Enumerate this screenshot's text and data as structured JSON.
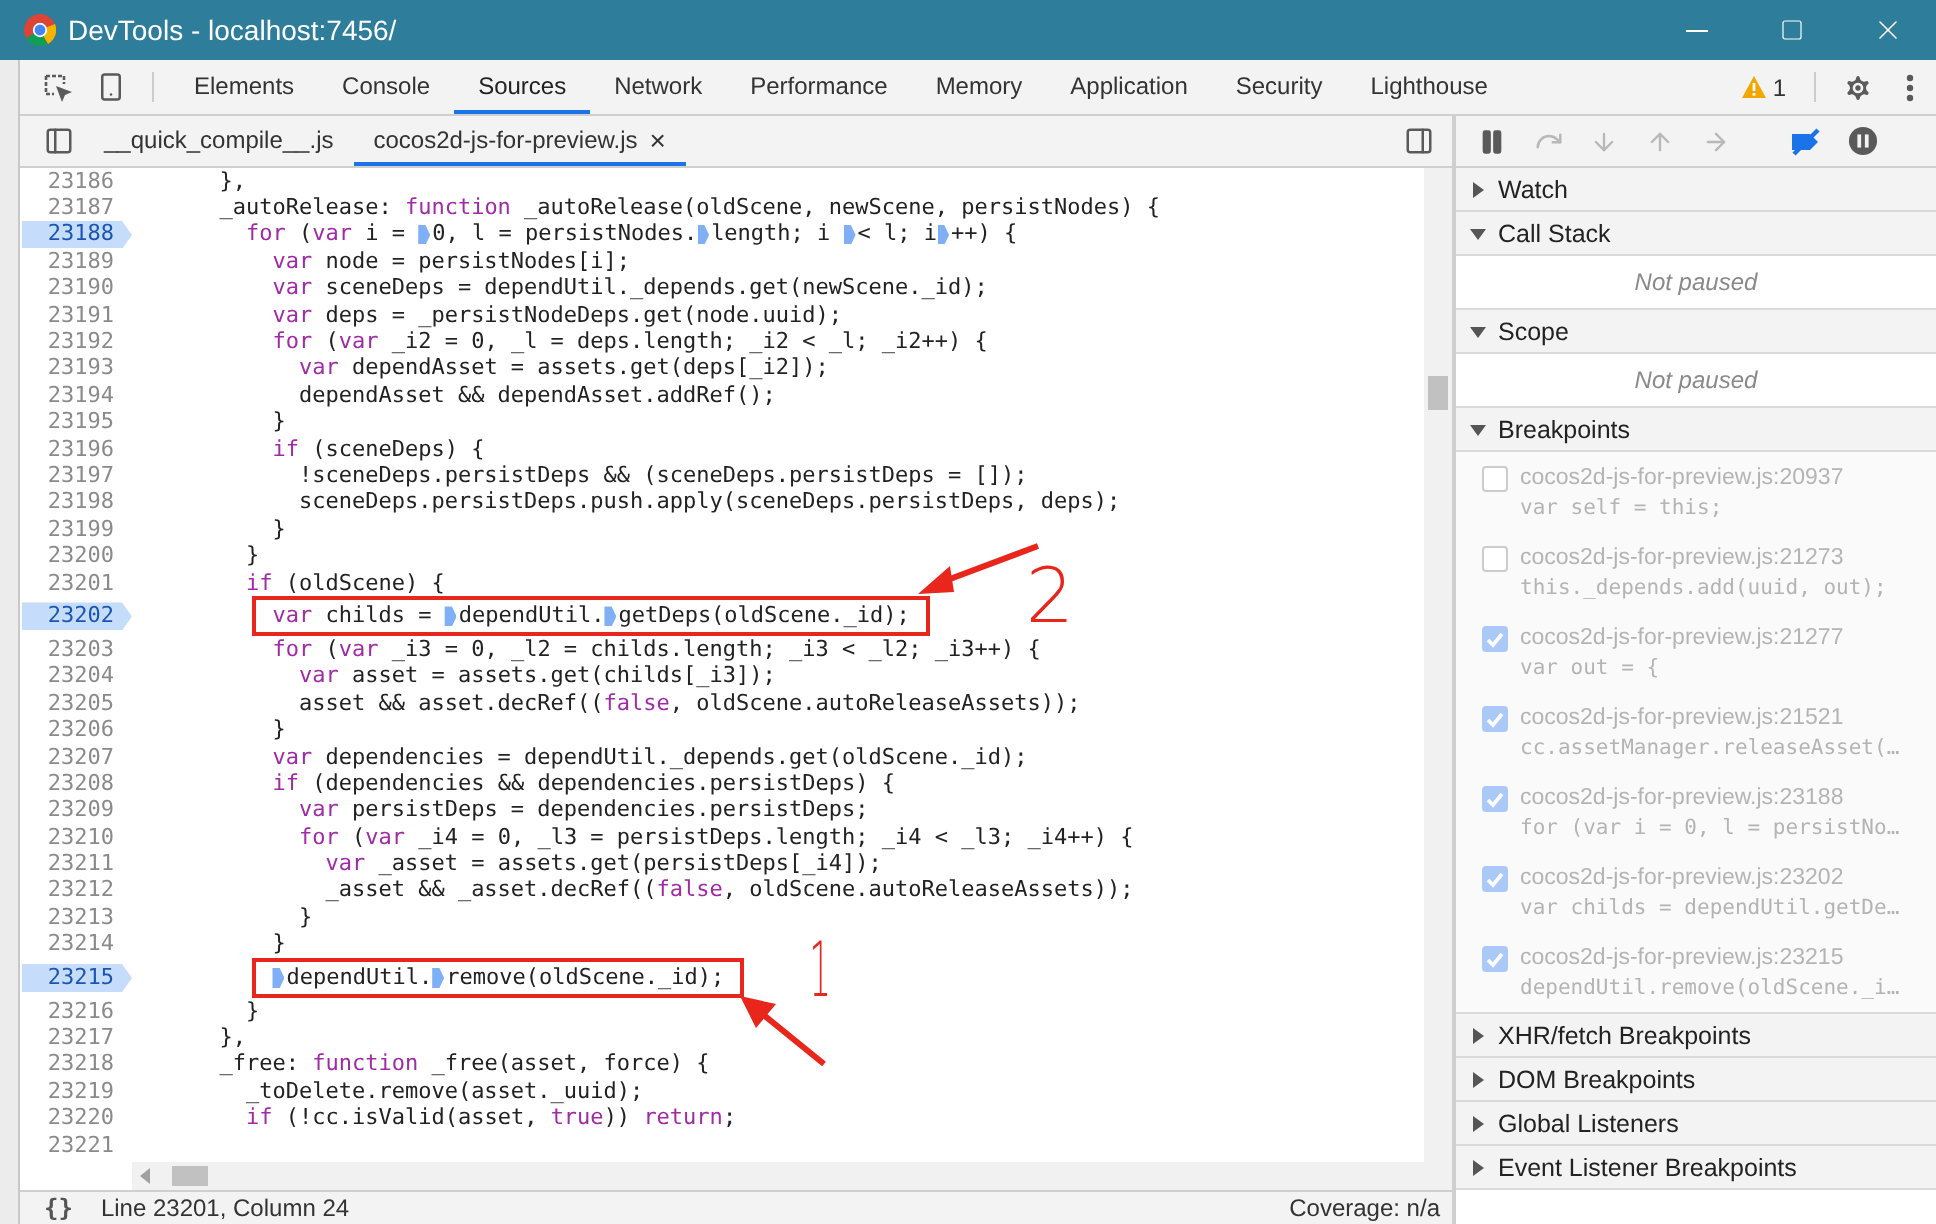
{
  "window": {
    "title": "DevTools - localhost:7456/"
  },
  "main_tabs": [
    {
      "label": "Elements",
      "selected": false
    },
    {
      "label": "Console",
      "selected": false
    },
    {
      "label": "Sources",
      "selected": true
    },
    {
      "label": "Network",
      "selected": false
    },
    {
      "label": "Performance",
      "selected": false
    },
    {
      "label": "Memory",
      "selected": false
    },
    {
      "label": "Application",
      "selected": false
    },
    {
      "label": "Security",
      "selected": false
    },
    {
      "label": "Lighthouse",
      "selected": false
    }
  ],
  "warning_count": "1",
  "file_tabs": [
    {
      "label": "__quick_compile__.js",
      "selected": false,
      "closable": false
    },
    {
      "label": "cocos2d-js-for-preview.js",
      "selected": true,
      "closable": true
    }
  ],
  "close_glyph": "×",
  "debug_toolbar": [
    {
      "kind": "pause",
      "disabled": false,
      "on": false
    },
    {
      "kind": "step_over",
      "disabled": true
    },
    {
      "kind": "step_into",
      "disabled": true
    },
    {
      "kind": "step_out",
      "disabled": true
    },
    {
      "kind": "step",
      "disabled": true
    },
    {
      "kind": "deactivate_breakpoints",
      "disabled": false,
      "on": true
    },
    {
      "kind": "pause_on_exceptions",
      "disabled": false,
      "on": false
    }
  ],
  "code_lines": [
    {
      "number": "23186",
      "breakpoint": false,
      "code": [
        {
          "kind": "plain",
          "text": "      },"
        }
      ]
    },
    {
      "number": "23187",
      "breakpoint": false,
      "code": [
        {
          "kind": "plain",
          "text": "      _autoRelease: "
        },
        {
          "kind": "keyword",
          "text": "function"
        },
        {
          "kind": "plain",
          "text": " _autoRelease(oldScene, newScene, persistNodes) {"
        }
      ]
    },
    {
      "number": "23188",
      "breakpoint": true,
      "code": [
        {
          "kind": "keyword",
          "text": "        for"
        },
        {
          "kind": "plain",
          "text": " ("
        },
        {
          "kind": "keyword",
          "text": "var"
        },
        {
          "kind": "plain",
          "text": " i = "
        },
        {
          "kind": "marker"
        },
        {
          "kind": "plain",
          "text": "0, l = persistNodes."
        },
        {
          "kind": "marker"
        },
        {
          "kind": "plain",
          "text": "length; i "
        },
        {
          "kind": "marker"
        },
        {
          "kind": "plain",
          "text": "< l; i"
        },
        {
          "kind": "marker"
        },
        {
          "kind": "plain",
          "text": "++) {"
        }
      ]
    },
    {
      "number": "23189",
      "breakpoint": false,
      "code": [
        {
          "kind": "keyword",
          "text": "          var"
        },
        {
          "kind": "plain",
          "text": " node = persistNodes[i];"
        }
      ]
    },
    {
      "number": "23190",
      "breakpoint": false,
      "code": [
        {
          "kind": "keyword",
          "text": "          var"
        },
        {
          "kind": "plain",
          "text": " sceneDeps = dependUtil._depends.get(newScene._id);"
        }
      ]
    },
    {
      "number": "23191",
      "breakpoint": false,
      "code": [
        {
          "kind": "keyword",
          "text": "          var"
        },
        {
          "kind": "plain",
          "text": " deps = _persistNodeDeps.get(node.uuid);"
        }
      ]
    },
    {
      "number": "23192",
      "breakpoint": false,
      "code": [
        {
          "kind": "keyword",
          "text": "          for"
        },
        {
          "kind": "plain",
          "text": " ("
        },
        {
          "kind": "keyword",
          "text": "var"
        },
        {
          "kind": "plain",
          "text": " _i2 = 0, _l = deps.length; _i2 < _l; _i2++) {"
        }
      ]
    },
    {
      "number": "23193",
      "breakpoint": false,
      "code": [
        {
          "kind": "keyword",
          "text": "            var"
        },
        {
          "kind": "plain",
          "text": " dependAsset = assets.get(deps[_i2]);"
        }
      ]
    },
    {
      "number": "23194",
      "breakpoint": false,
      "code": [
        {
          "kind": "plain",
          "text": "            dependAsset && dependAsset.addRef();"
        }
      ]
    },
    {
      "number": "23195",
      "breakpoint": false,
      "code": [
        {
          "kind": "plain",
          "text": "          }"
        }
      ]
    },
    {
      "number": "23196",
      "breakpoint": false,
      "code": [
        {
          "kind": "keyword",
          "text": "          if"
        },
        {
          "kind": "plain",
          "text": " (sceneDeps) {"
        }
      ]
    },
    {
      "number": "23197",
      "breakpoint": false,
      "code": [
        {
          "kind": "plain",
          "text": "            !sceneDeps.persistDeps && (sceneDeps.persistDeps = []);"
        }
      ]
    },
    {
      "number": "23198",
      "breakpoint": false,
      "code": [
        {
          "kind": "plain",
          "text": "            sceneDeps.persistDeps.push.apply(sceneDeps.persistDeps, deps);"
        }
      ]
    },
    {
      "number": "23199",
      "breakpoint": false,
      "code": [
        {
          "kind": "plain",
          "text": "          }"
        }
      ]
    },
    {
      "number": "23200",
      "breakpoint": false,
      "code": [
        {
          "kind": "plain",
          "text": "        }"
        }
      ]
    },
    {
      "number": "23201",
      "breakpoint": false,
      "code": [
        {
          "kind": "keyword",
          "text": "        if"
        },
        {
          "kind": "plain",
          "text": " (oldScene) {"
        }
      ]
    },
    {
      "number": "23202",
      "breakpoint": true,
      "boxed": true,
      "callout": {
        "label": "2",
        "kind": "right"
      },
      "code": [
        {
          "kind": "keyword",
          "text": "          var"
        },
        {
          "kind": "plain",
          "text": " childs = "
        },
        {
          "kind": "marker"
        },
        {
          "kind": "plain",
          "text": "dependUtil."
        },
        {
          "kind": "marker"
        },
        {
          "kind": "plain",
          "text": "getDeps(oldScene._id);"
        }
      ]
    },
    {
      "number": "23203",
      "breakpoint": false,
      "code": [
        {
          "kind": "keyword",
          "text": "          for"
        },
        {
          "kind": "plain",
          "text": " ("
        },
        {
          "kind": "keyword",
          "text": "var"
        },
        {
          "kind": "plain",
          "text": " _i3 = 0, _l2 = childs.length; _i3 < _l2; _i3++) {"
        }
      ]
    },
    {
      "number": "23204",
      "breakpoint": false,
      "code": [
        {
          "kind": "keyword",
          "text": "            var"
        },
        {
          "kind": "plain",
          "text": " asset = assets.get(childs[_i3]);"
        }
      ]
    },
    {
      "number": "23205",
      "breakpoint": false,
      "code": [
        {
          "kind": "plain",
          "text": "            asset && asset.decRef(("
        },
        {
          "kind": "keyword",
          "text": "false"
        },
        {
          "kind": "plain",
          "text": ", oldScene.autoReleaseAssets));"
        }
      ]
    },
    {
      "number": "23206",
      "breakpoint": false,
      "code": [
        {
          "kind": "plain",
          "text": "          }"
        }
      ]
    },
    {
      "number": "23207",
      "breakpoint": false,
      "code": [
        {
          "kind": "keyword",
          "text": "          var"
        },
        {
          "kind": "plain",
          "text": " dependencies = dependUtil._depends.get(oldScene._id);"
        }
      ]
    },
    {
      "number": "23208",
      "breakpoint": false,
      "code": [
        {
          "kind": "keyword",
          "text": "          if"
        },
        {
          "kind": "plain",
          "text": " (dependencies && dependencies.persistDeps) {"
        }
      ]
    },
    {
      "number": "23209",
      "breakpoint": false,
      "code": [
        {
          "kind": "keyword",
          "text": "            var"
        },
        {
          "kind": "plain",
          "text": " persistDeps = dependencies.persistDeps;"
        }
      ]
    },
    {
      "number": "23210",
      "breakpoint": false,
      "code": [
        {
          "kind": "keyword",
          "text": "            for"
        },
        {
          "kind": "plain",
          "text": " ("
        },
        {
          "kind": "keyword",
          "text": "var"
        },
        {
          "kind": "plain",
          "text": " _i4 = 0, _l3 = persistDeps.length; _i4 < _l3; _i4++) {"
        }
      ]
    },
    {
      "number": "23211",
      "breakpoint": false,
      "code": [
        {
          "kind": "keyword",
          "text": "              var"
        },
        {
          "kind": "plain",
          "text": " _asset = assets.get(persistDeps[_i4]);"
        }
      ]
    },
    {
      "number": "23212",
      "breakpoint": false,
      "code": [
        {
          "kind": "plain",
          "text": "              _asset && _asset.decRef(("
        },
        {
          "kind": "keyword",
          "text": "false"
        },
        {
          "kind": "plain",
          "text": ", oldScene.autoReleaseAssets));"
        }
      ]
    },
    {
      "number": "23213",
      "breakpoint": false,
      "code": [
        {
          "kind": "plain",
          "text": "            }"
        }
      ]
    },
    {
      "number": "23214",
      "breakpoint": false,
      "code": [
        {
          "kind": "plain",
          "text": "          }"
        }
      ]
    },
    {
      "number": "23215",
      "breakpoint": true,
      "boxed": true,
      "callout": {
        "label": "1",
        "kind": "below"
      },
      "code": [
        {
          "kind": "plain",
          "text": "          dependUtil.",
          "marked": true
        },
        {
          "kind": "marker"
        },
        {
          "kind": "plain",
          "text": "remove(oldScene._id);"
        }
      ]
    },
    {
      "number": "23216",
      "breakpoint": false,
      "code": [
        {
          "kind": "plain",
          "text": "        }"
        }
      ]
    },
    {
      "number": "23217",
      "breakpoint": false,
      "code": [
        {
          "kind": "plain",
          "text": "      },"
        }
      ]
    },
    {
      "number": "23218",
      "breakpoint": false,
      "code": [
        {
          "kind": "plain",
          "text": "      _free: "
        },
        {
          "kind": "keyword",
          "text": "function"
        },
        {
          "kind": "plain",
          "text": " _free(asset, force) {"
        }
      ]
    },
    {
      "number": "23219",
      "breakpoint": false,
      "code": [
        {
          "kind": "plain",
          "text": "        _toDelete.remove(asset._uuid);"
        }
      ]
    },
    {
      "number": "23220",
      "breakpoint": false,
      "code": [
        {
          "kind": "keyword",
          "text": "        if"
        },
        {
          "kind": "plain",
          "text": " (!cc.isValid(asset, "
        },
        {
          "kind": "keyword",
          "text": "true"
        },
        {
          "kind": "plain",
          "text": ")) "
        },
        {
          "kind": "keyword",
          "text": "return"
        },
        {
          "kind": "plain",
          "text": ";"
        }
      ]
    },
    {
      "number": "23221",
      "breakpoint": false
    }
  ],
  "status_bar": {
    "format_button": "{}",
    "position": "Line 23201, Column 24",
    "coverage": "Coverage: n/a"
  },
  "sidebar_sections": [
    {
      "title": "Watch",
      "expanded": false
    },
    {
      "title": "Call Stack",
      "expanded": true,
      "message": "Not paused"
    },
    {
      "title": "Scope",
      "expanded": true,
      "message": "Not paused"
    },
    {
      "title": "Breakpoints",
      "expanded": true,
      "items": [
        {
          "location": "cocos2d-js-for-preview.js:20937",
          "code": "var self = this;",
          "checked": false
        },
        {
          "location": "cocos2d-js-for-preview.js:21273",
          "code": "this._depends.add(uuid, out);",
          "checked": false
        },
        {
          "location": "cocos2d-js-for-preview.js:21277",
          "code": "var out = {",
          "checked": true
        },
        {
          "location": "cocos2d-js-for-preview.js:21521",
          "code": "cc.assetManager.releaseAsset(…",
          "checked": true
        },
        {
          "location": "cocos2d-js-for-preview.js:23188",
          "code": "for (var i = 0, l = persistNo…",
          "checked": true
        },
        {
          "location": "cocos2d-js-for-preview.js:23202",
          "code": "var childs = dependUtil.getDe…",
          "checked": true
        },
        {
          "location": "cocos2d-js-for-preview.js:23215",
          "code": "dependUtil.remove(oldScene._i…",
          "checked": true
        }
      ]
    },
    {
      "title": "XHR/fetch Breakpoints",
      "expanded": false
    },
    {
      "title": "DOM Breakpoints",
      "expanded": false
    },
    {
      "title": "Global Listeners",
      "expanded": false
    },
    {
      "title": "Event Listener Breakpoints",
      "expanded": false
    }
  ]
}
